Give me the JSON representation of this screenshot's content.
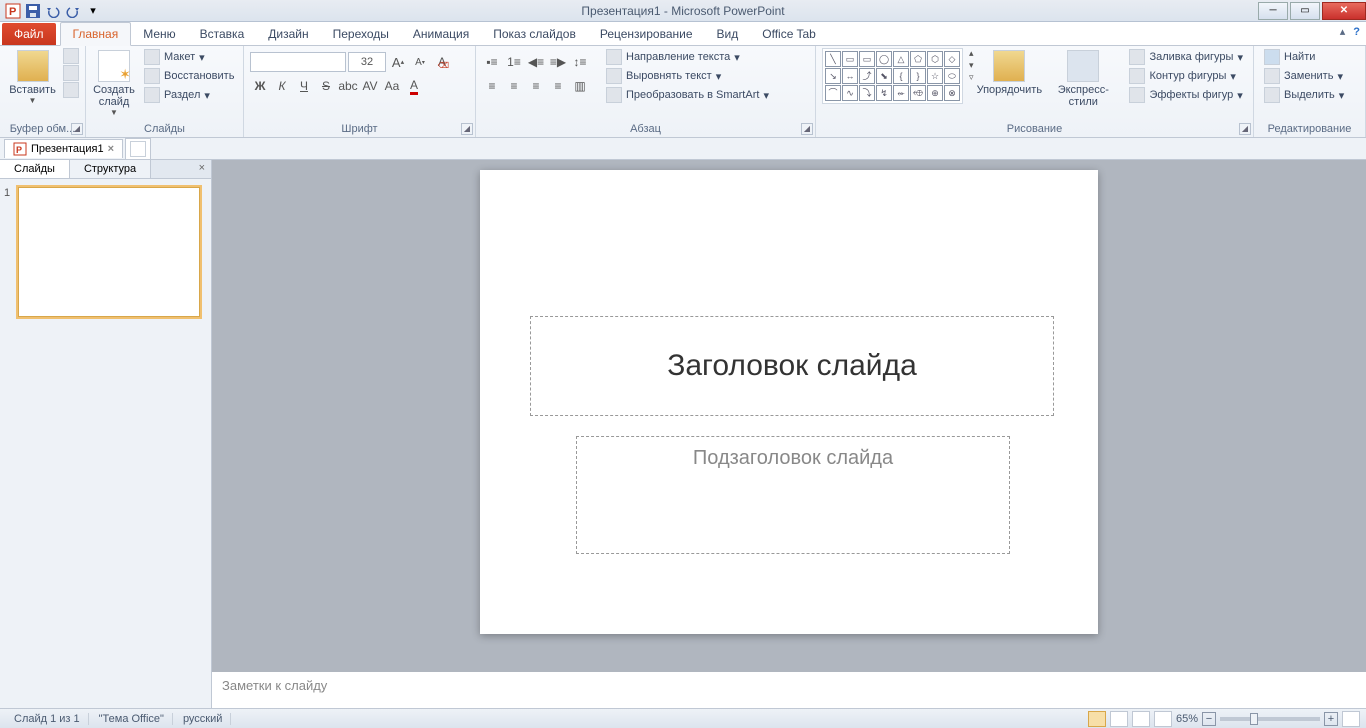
{
  "title": "Презентация1 - Microsoft PowerPoint",
  "tabs": {
    "file": "Файл",
    "home": "Главная",
    "menu": "Меню",
    "insert": "Вставка",
    "design": "Дизайн",
    "transitions": "Переходы",
    "animation": "Анимация",
    "slideshow": "Показ слайдов",
    "review": "Рецензирование",
    "view": "Вид",
    "officetab": "Office Tab"
  },
  "groups": {
    "clipboard": {
      "label": "Буфер обм...",
      "paste": "Вставить"
    },
    "slides": {
      "label": "Слайды",
      "new": "Создать\nслайд",
      "layout": "Макет",
      "reset": "Восстановить",
      "section": "Раздел"
    },
    "font": {
      "label": "Шрифт",
      "size": "32"
    },
    "paragraph": {
      "label": "Абзац",
      "textdir": "Направление текста",
      "align": "Выровнять текст",
      "smartart": "Преобразовать в SmartArt"
    },
    "drawing": {
      "label": "Рисование",
      "arrange": "Упорядочить",
      "quick": "Экспресс-стили",
      "fill": "Заливка фигуры",
      "outline": "Контур фигуры",
      "effects": "Эффекты фигур"
    },
    "editing": {
      "label": "Редактирование",
      "find": "Найти",
      "replace": "Заменить",
      "select": "Выделить"
    }
  },
  "doctab": "Презентация1",
  "pane": {
    "slides": "Слайды",
    "outline": "Структура",
    "thumb_num": "1"
  },
  "slide": {
    "title_ph": "Заголовок слайда",
    "subtitle_ph": "Подзаголовок слайда"
  },
  "notes_ph": "Заметки к слайду",
  "status": {
    "slide": "Слайд 1 из 1",
    "theme": "\"Тема Office\"",
    "lang": "русский",
    "zoom": "65%"
  }
}
